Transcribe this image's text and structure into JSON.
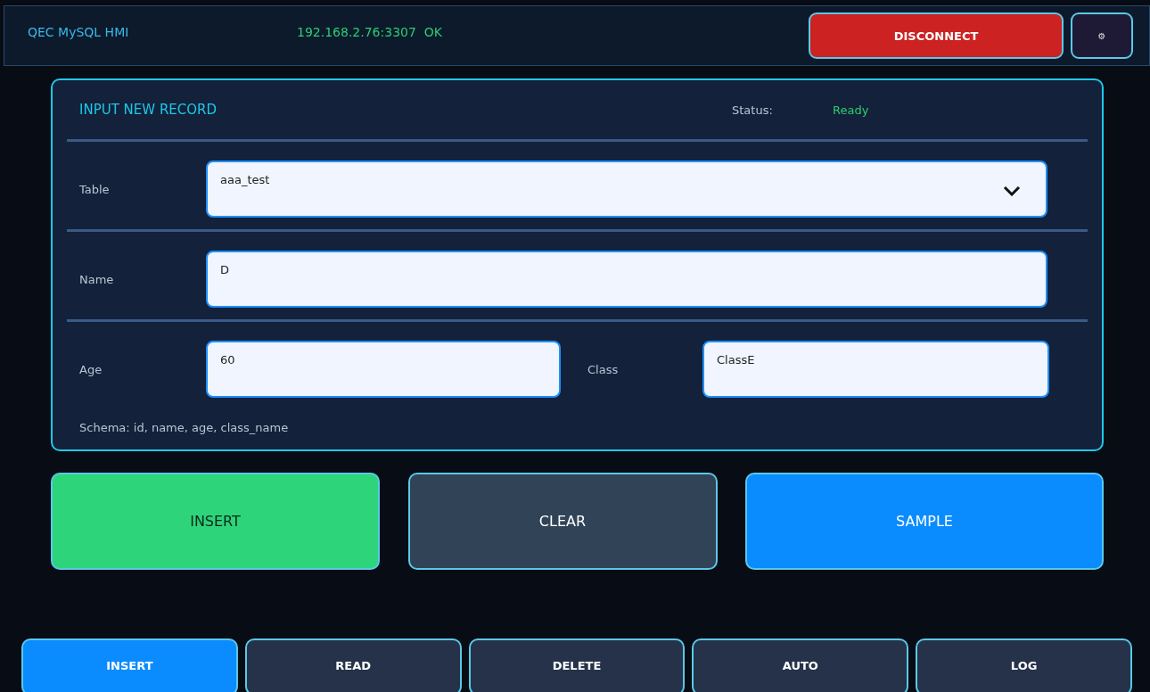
{
  "header": {
    "title": "QEC MySQL HMI",
    "connection": "192.168.2.76:3307  OK",
    "connected": true,
    "disconnect_button": "DISCONNECT",
    "settings_button": "⚙"
  },
  "form": {
    "title": "INPUT NEW RECORD",
    "status_label": "Status:",
    "status": "Ready",
    "fields": [
      {
        "label": "Table",
        "value": "aaa_test",
        "kind": "dropdown"
      },
      {
        "label": "Name",
        "value": "D",
        "kind": "text"
      }
    ],
    "pair": [
      {
        "label": "Age",
        "value": "60"
      },
      {
        "label": "Class",
        "value": "ClassE"
      }
    ],
    "note": "Schema: id, name, age, class_name"
  },
  "actions": [
    {
      "label": "INSERT",
      "kind": "success"
    },
    {
      "label": "CLEAR",
      "kind": "neutral"
    },
    {
      "label": "SAMPLE",
      "kind": "primary"
    }
  ],
  "tabs": [
    {
      "label": "INSERT",
      "selected": true
    },
    {
      "label": "READ",
      "selected": false
    },
    {
      "label": "DELETE",
      "selected": false
    },
    {
      "label": "AUTO",
      "selected": false
    },
    {
      "label": "LOG",
      "selected": false
    }
  ]
}
